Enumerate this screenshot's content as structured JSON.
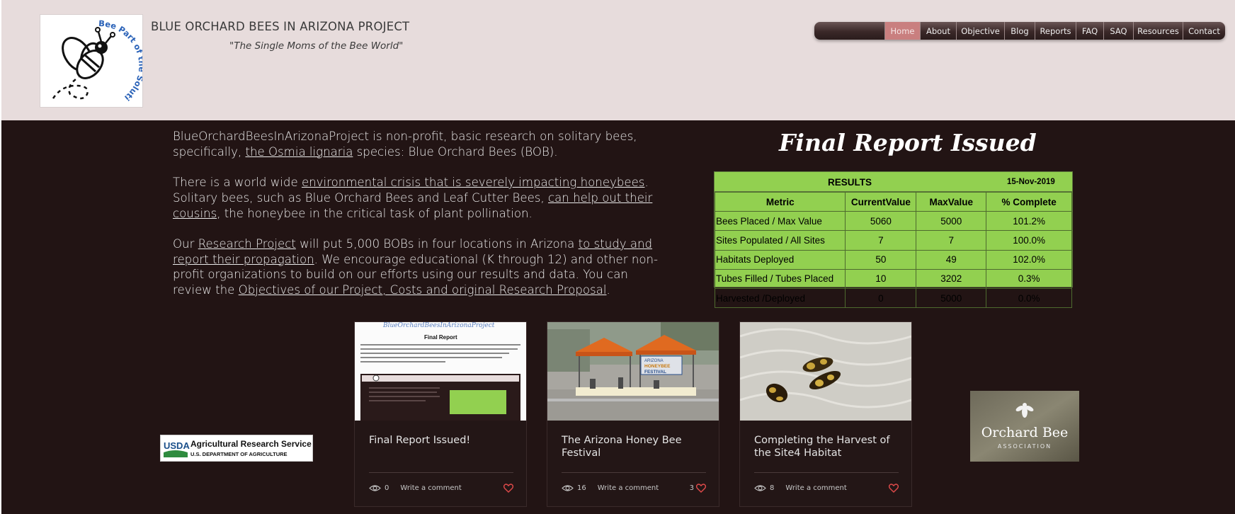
{
  "header": {
    "site_title": "BLUE ORCHARD BEES IN ARIZONA PROJECT",
    "tagline": "\"The Single Moms of the Bee World\"",
    "logo_text": "Bee Part of the Solution"
  },
  "nav": {
    "items": [
      {
        "label": "Home",
        "active": true
      },
      {
        "label": "About"
      },
      {
        "label": "Objective"
      },
      {
        "label": "Blog"
      },
      {
        "label": "Reports"
      },
      {
        "label": "FAQ"
      },
      {
        "label": "SAQ"
      },
      {
        "label": "Resources"
      },
      {
        "label": "Contact"
      }
    ]
  },
  "intro": {
    "p1_a": "BlueOrchardBeesInArizonaProject is non-profit, basic research on solitary bees, specifically, ",
    "p1_link": "the Osmia lignaria",
    "p1_b": " species: Blue Orchard Bees (BOB).",
    "p2_a": "There is a world wide ",
    "p2_link1": "environmental crisis that is severely impacting honeybees",
    "p2_b": ". Solitary bees, such as Blue Orchard Bees  and Leaf Cutter Bees, ",
    "p2_link2": "can help out their cousins",
    "p2_c": ", the honeybee in the critical task of plant pollination.",
    "p3_a": "Our ",
    "p3_link1": "Research Project",
    "p3_b": " will put 5,000 BOBs in four locations in Arizona ",
    "p3_link2": "to study and report their propagation",
    "p3_c": ". We encourage educational (K through 12) and other non-profit organizations to build on our efforts using our results and data. You can review the ",
    "p3_link3": "Objectives of our Project, Costs and original Research Proposal",
    "p3_d": "."
  },
  "report": {
    "heading": "Final Report Issued",
    "table_title": "RESULTS",
    "table_date": "15-Nov-2019",
    "columns": [
      "Metric",
      "CurrentValue",
      "MaxValue",
      "% Complete"
    ],
    "rows": [
      [
        "Bees Placed / Max Value",
        "5060",
        "5000",
        "101.2%"
      ],
      [
        "Sites Populated / All Sites",
        "7",
        "7",
        "100.0%"
      ],
      [
        "Habitats Deployed",
        "50",
        "49",
        "102.0%"
      ],
      [
        "Tubes Filled / Tubes Placed",
        "10",
        "3202",
        "0.3%"
      ],
      [
        "Harvested /Deployed",
        "0",
        "5000",
        "0.0%"
      ]
    ]
  },
  "posts": [
    {
      "title": "Final Report Issued!",
      "views": "0",
      "comment": "Write a comment",
      "likes": "",
      "thumb_title": "BlueOrchardBeesInArizonaProject",
      "thumb_heading": "Final Report"
    },
    {
      "title": "The Arizona Honey Bee Festival",
      "views": "16",
      "comment": "Write a comment",
      "likes": "3",
      "thumb_sign_a": "ARIZONA",
      "thumb_sign_b": "HONEYBEE",
      "thumb_sign_c": "FESTIVAL"
    },
    {
      "title": "Completing the Harvest of the Site4 Habitat",
      "views": "8",
      "comment": "Write a comment",
      "likes": ""
    }
  ],
  "sponsors": {
    "usda_main": "Agricultural Research Service",
    "usda_sub": "U.S. DEPARTMENT OF AGRICULTURE",
    "usda_mark": "USDA",
    "orchard_name": "Orchard Bee",
    "orchard_sub": "ASSOCIATION"
  },
  "colors": {
    "header_bg": "#e7dcdc",
    "main_bg": "#221414",
    "nav_active": "#c97f7f",
    "table_green": "#92d050",
    "like_heart": "#e04a4a"
  }
}
